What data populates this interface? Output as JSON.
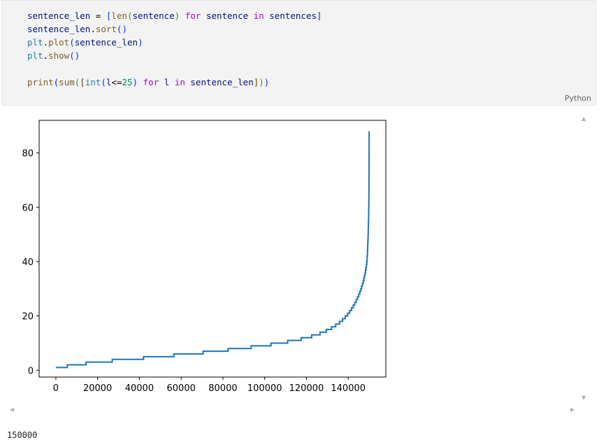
{
  "code_cell": {
    "language": "Python",
    "lines": [
      "sentence_len = [len(sentence) for sentence in sentences]",
      "sentence_len.sort()",
      "plt.plot(sentence_len)",
      "plt.show()",
      "",
      "print(sum([int(l<=25) for l in sentence_len]))"
    ]
  },
  "chart_data": {
    "type": "line",
    "title": "",
    "xlabel": "",
    "ylabel": "",
    "xlim": [
      -8000,
      158000
    ],
    "ylim": [
      -2.5,
      92
    ],
    "xticks": [
      0,
      20000,
      40000,
      60000,
      80000,
      100000,
      120000,
      140000
    ],
    "xtick_labels": [
      "0",
      "20000",
      "40000",
      "60000",
      "80000",
      "100000",
      "120000",
      "140000"
    ],
    "yticks": [
      0,
      20,
      40,
      60,
      80
    ],
    "ytick_labels": [
      "0",
      "20",
      "40",
      "60",
      "80"
    ],
    "grid": false,
    "line_color": "#1f77b4",
    "series": [
      {
        "x": [
          0,
          5500,
          14500,
          27000,
          42000,
          56500,
          70500,
          82500,
          93500,
          103000,
          111000,
          117500,
          122500,
          126500,
          129500,
          132000,
          134000,
          135800,
          137300,
          138600,
          139700,
          140700,
          141600,
          142400,
          143100,
          143800,
          144400,
          145000,
          145500,
          146000,
          146400,
          146800,
          147200,
          147500,
          147800,
          148100,
          148300,
          148500,
          148700,
          148900,
          149050,
          149200,
          149300,
          149400,
          149500,
          149580,
          149650,
          149720,
          149780,
          149830,
          149870,
          149910,
          149940,
          149960,
          149980,
          150000
        ],
        "y": [
          1,
          2,
          3,
          4,
          5,
          6,
          7,
          8,
          9,
          10,
          11,
          12,
          13,
          14,
          15,
          16,
          17,
          18,
          19,
          20,
          21,
          22,
          23,
          24,
          25,
          26,
          27,
          28,
          29,
          30,
          31,
          32,
          33,
          34,
          35,
          36,
          37,
          38,
          39,
          40,
          42,
          44,
          46,
          48,
          50,
          52,
          54,
          56,
          58,
          60,
          63,
          66,
          70,
          75,
          80,
          88
        ]
      }
    ]
  },
  "output": {
    "printed_value": "150000"
  }
}
